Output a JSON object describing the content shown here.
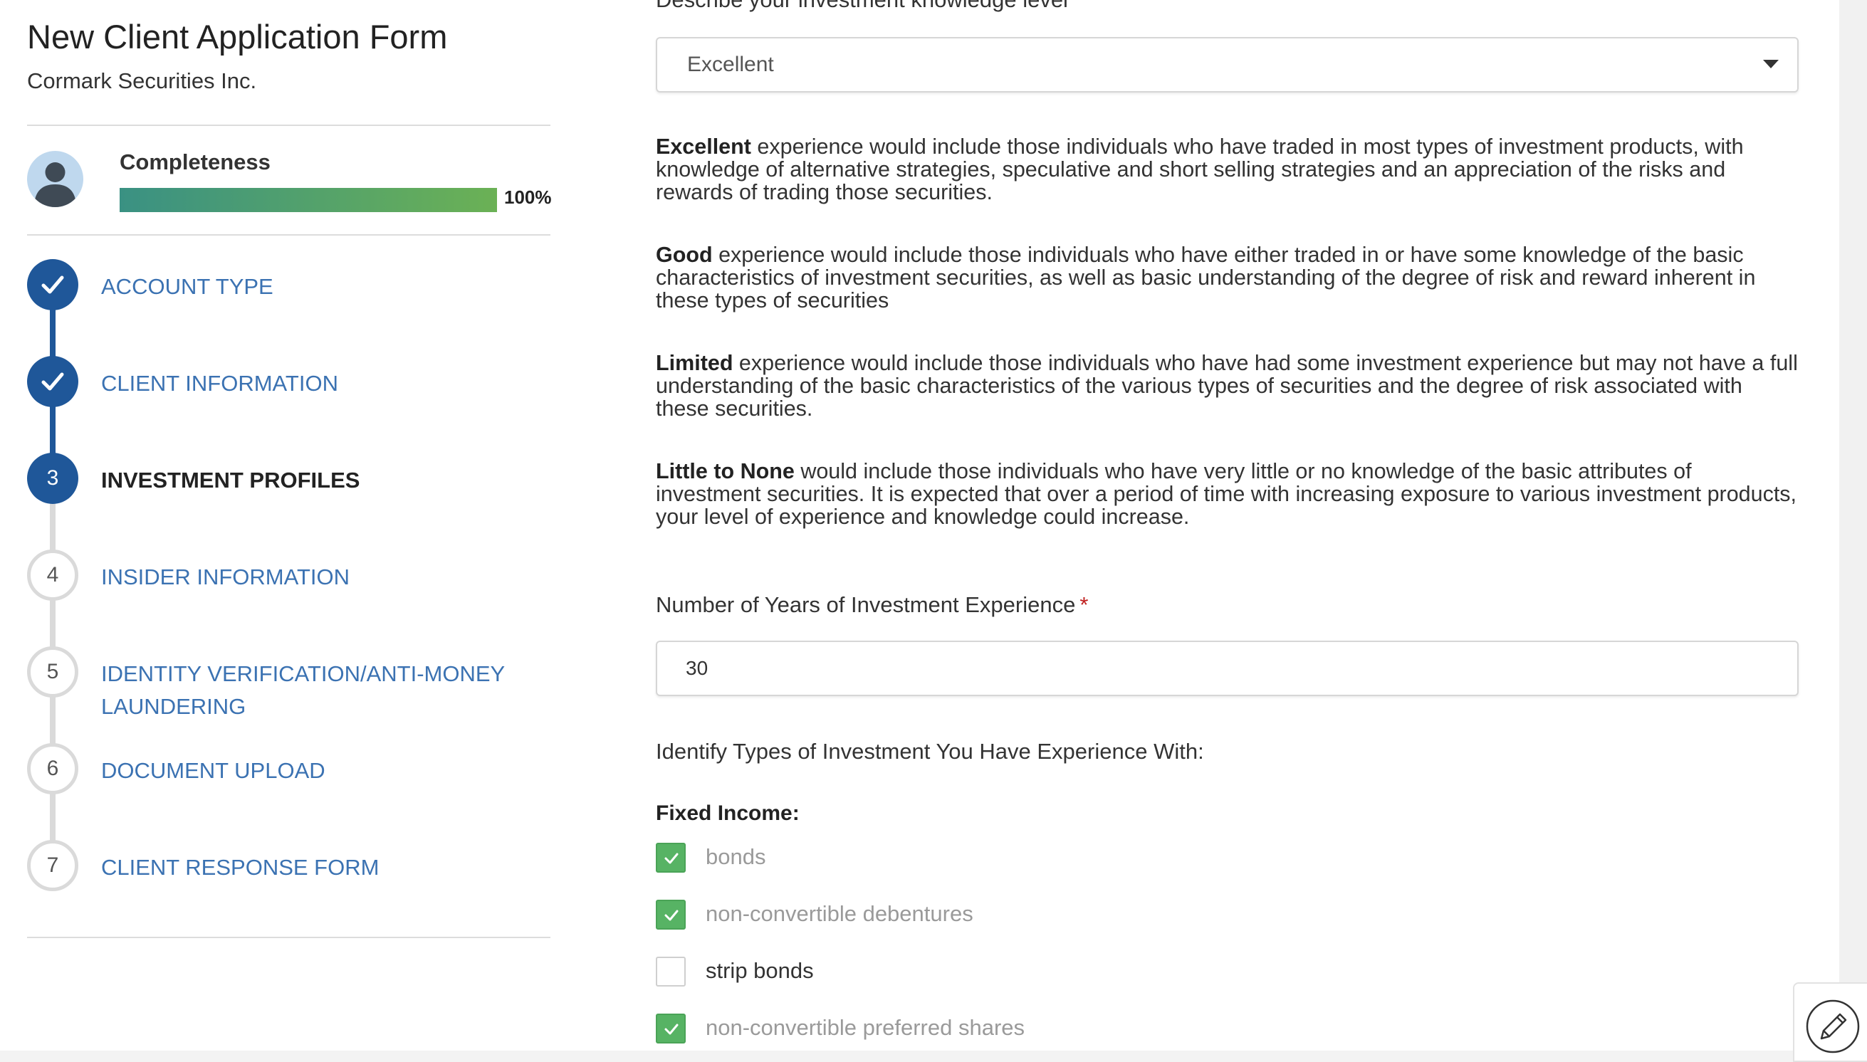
{
  "sidebar": {
    "title": "New Client Application Form",
    "company": "Cormark Securities Inc.",
    "completeness": {
      "label": "Completeness",
      "percent_text": "100%",
      "fraction": 1.0
    },
    "steps": [
      {
        "marker": "✓",
        "label": "ACCOUNT TYPE",
        "status": "done"
      },
      {
        "marker": "✓",
        "label": "CLIENT INFORMATION",
        "status": "done"
      },
      {
        "marker": "3",
        "label": "INVESTMENT PROFILES",
        "status": "current"
      },
      {
        "marker": "4",
        "label": "INSIDER INFORMATION",
        "status": "todo"
      },
      {
        "marker": "5",
        "label_line1": "IDENTITY VERIFICATION/ANTI-MONEY",
        "label_line2": "LAUNDERING",
        "status": "todo"
      },
      {
        "marker": "6",
        "label": "DOCUMENT UPLOAD",
        "status": "todo"
      },
      {
        "marker": "7",
        "label": "CLIENT RESPONSE FORM",
        "status": "todo"
      }
    ]
  },
  "main": {
    "knowledge": {
      "label": "Describe your investment knowledge level",
      "required_mark": "*",
      "selected": "Excellent"
    },
    "descriptions": [
      {
        "term": "Excellent",
        "text": " experience would include those individuals who have traded in most types of investment products, with knowledge of alternative strategies, speculative and short selling strategies and an appreciation of the risks and rewards of trading those securities."
      },
      {
        "term": "Good",
        "text": " experience would include those individuals who have either traded in or have some knowledge of the basic characteristics of investment securities, as well as basic understanding of the degree of risk and reward inherent in these types of securities"
      },
      {
        "term": "Limited",
        "text": " experience would include those individuals who have had some investment experience but may not have a full understanding of the basic characteristics of the various types of securities and the degree of risk associated with these securities."
      },
      {
        "term": "Little to None",
        "text": " would include those individuals who have very little or no knowledge of the basic attributes of investment securities. It is expected that over a period of time with increasing exposure to various investment products, your level of experience and knowledge could increase."
      }
    ],
    "years": {
      "label": "Number of Years of Investment Experience",
      "required_mark": "*",
      "value": "30"
    },
    "types_heading": "Identify Types of Investment You Have Experience With:",
    "fixed_income": {
      "title": "Fixed Income:",
      "options": [
        {
          "label": "bonds",
          "checked": true
        },
        {
          "label": "non-convertible debentures",
          "checked": true
        },
        {
          "label": "strip bonds",
          "checked": false
        },
        {
          "label": "non-convertible preferred shares",
          "checked": true
        }
      ]
    }
  },
  "colors": {
    "primary": "#1f5799",
    "link": "#3b72b2",
    "check_green": "#57b364",
    "required": "#c0201f"
  },
  "icons": {
    "avatar": "user-avatar-icon",
    "done_marker": "checkmark-icon",
    "select_caret": "caret-down-icon",
    "edit": "pencil-icon"
  }
}
